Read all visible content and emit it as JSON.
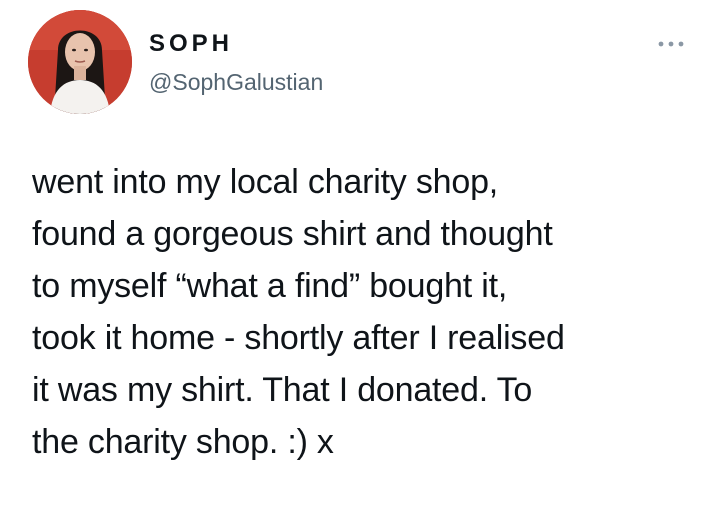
{
  "author": {
    "display_name": "SOPH",
    "handle": "@SophGalustian",
    "avatar": "avatar-photo"
  },
  "more_icon": "more-options-icon",
  "tweet": {
    "lines": [
      "went into my local charity shop,",
      "found a gorgeous shirt and thought",
      "to myself “what a find” bought it,",
      "took it home - shortly after I realised",
      "it was my shirt. That I donated. To",
      "the charity shop. :) x"
    ]
  },
  "colors": {
    "text": "#0f1419",
    "secondary_text": "#536471",
    "icon": "#8b98a5",
    "avatar_bg": "#c63d2f"
  }
}
